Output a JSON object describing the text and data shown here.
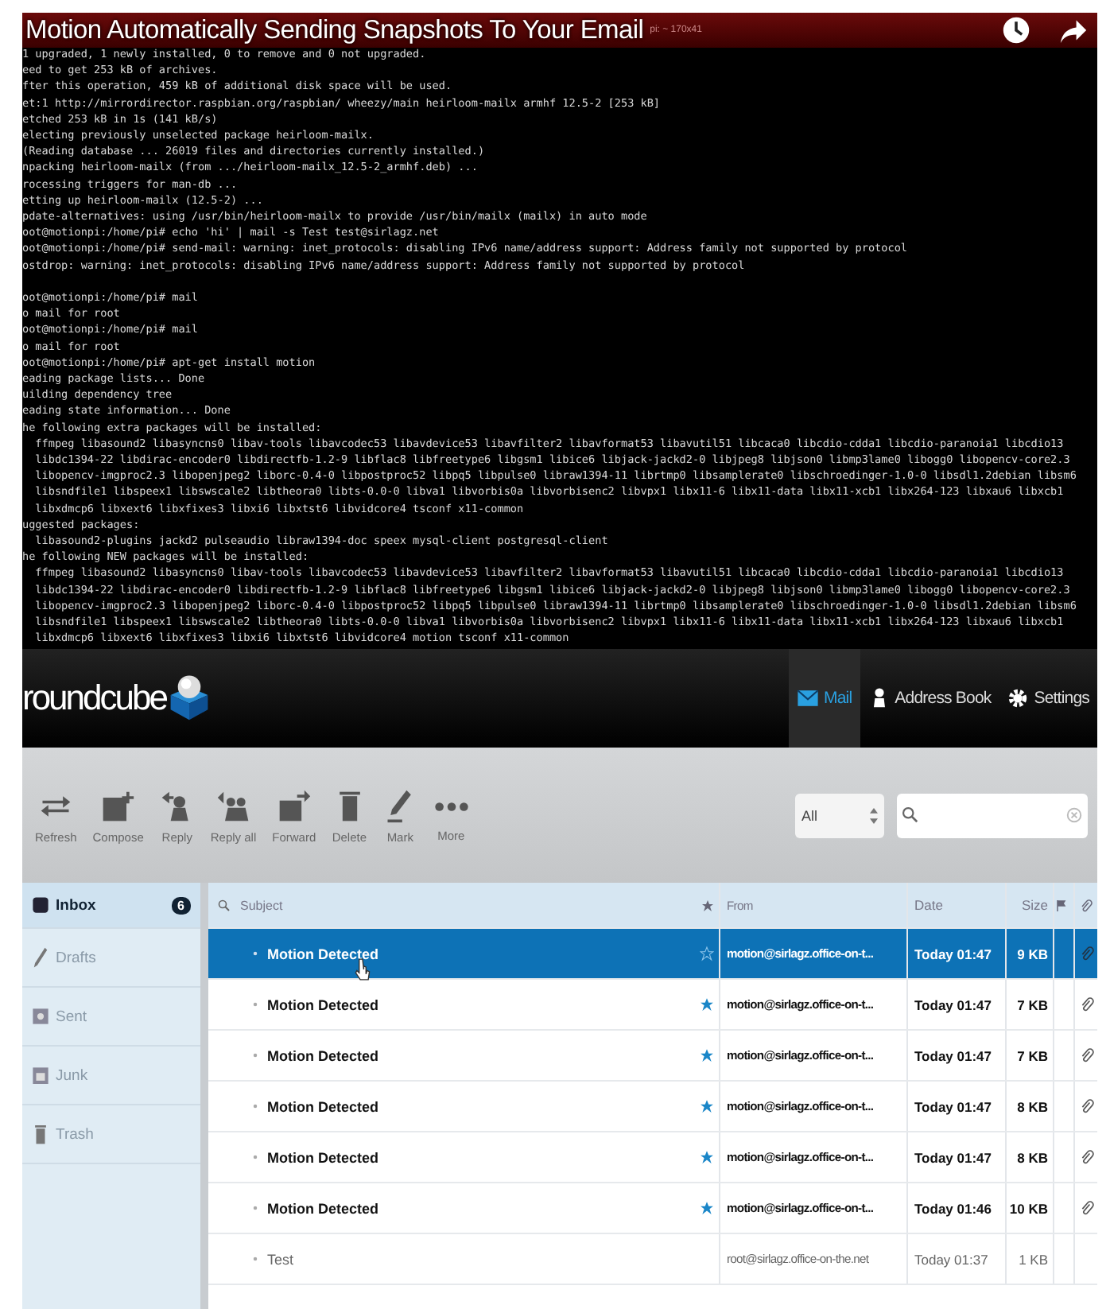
{
  "video": {
    "title": "Motion Automatically Sending Snapshots To Your Email",
    "terminal_title": "pi: ~ 170x41"
  },
  "terminal": {
    "blocks": [
      [
        "1 upgraded, 1 newly installed, 0 to remove and 0 not upgraded.",
        "eed to get 253 kB of archives.",
        "fter this operation, 459 kB of additional disk space will be used.",
        "et:1 http://mirrordirector.raspbian.org/raspbian/ wheezy/main heirloom-mailx armhf 12.5-2 [253 kB]",
        "etched 253 kB in 1s (141 kB/s)",
        "electing previously unselected package heirloom-mailx.",
        "(Reading database ... 26019 files and directories currently installed.)",
        "npacking heirloom-mailx (from .../heirloom-mailx_12.5-2_armhf.deb) ...",
        "rocessing triggers for man-db ...",
        "etting up heirloom-mailx (12.5-2) ...",
        "pdate-alternatives: using /usr/bin/heirloom-mailx to provide /usr/bin/mailx (mailx) in auto mode",
        "oot@motionpi:/home/pi# echo 'hi' | mail -s Test test@sirlagz.net",
        "oot@motionpi:/home/pi# send-mail: warning: inet_protocols: disabling IPv6 name/address support: Address family not supported by protocol",
        "ostdrop: warning: inet_protocols: disabling IPv6 name/address support: Address family not supported by protocol"
      ],
      [
        "oot@motionpi:/home/pi# mail",
        "o mail for root",
        "oot@motionpi:/home/pi# mail",
        "o mail for root",
        "oot@motionpi:/home/pi# apt-get install motion",
        "eading package lists... Done",
        "uilding dependency tree",
        "eading state information... Done",
        "he following extra packages will be installed:",
        "  ffmpeg libasound2 libasyncns0 libav-tools libavcodec53 libavdevice53 libavfilter2 libavformat53 libavutil51 libcaca0 libcdio-cdda1 libcdio-paranoia1 libcdio13",
        "  libdc1394-22 libdirac-encoder0 libdirectfb-1.2-9 libflac8 libfreetype6 libgsm1 libice6 libjack-jackd2-0 libjpeg8 libjson0 libmp3lame0 libogg0 libopencv-core2.3",
        "  libopencv-imgproc2.3 libopenjpeg2 liborc-0.4-0 libpostproc52 libpq5 libpulse0 libraw1394-11 librtmp0 libsamplerate0 libschroedinger-1.0-0 libsdl1.2debian libsm6",
        "  libsndfile1 libspeex1 libswscale2 libtheora0 libts-0.0-0 libva1 libvorbis0a libvorbisenc2 libvpx1 libx11-6 libx11-data libx11-xcb1 libx264-123 libxau6 libxcb1",
        "  libxdmcp6 libxext6 libxfixes3 libxi6 libxtst6 libvidcore4 tsconf x11-common",
        "uggested packages:",
        "  libasound2-plugins jackd2 pulseaudio libraw1394-doc speex mysql-client postgresql-client",
        "he following NEW packages will be installed:",
        "  ffmpeg libasound2 libasyncns0 libav-tools libavcodec53 libavdevice53 libavfilter2 libavformat53 libavutil51 libcaca0 libcdio-cdda1 libcdio-paranoia1 libcdio13",
        "  libdc1394-22 libdirac-encoder0 libdirectfb-1.2-9 libflac8 libfreetype6 libgsm1 libice6 libjack-jackd2-0 libjpeg8 libjson0 libmp3lame0 libogg0 libopencv-core2.3",
        "  libopencv-imgproc2.3 libopenjpeg2 liborc-0.4-0 libpostproc52 libpq5 libpulse0 libraw1394-11 librtmp0 libsamplerate0 libschroedinger-1.0-0 libsdl1.2debian libsm6",
        "  libsndfile1 libspeex1 libswscale2 libtheora0 libts-0.0-0 libva1 libvorbis0a libvorbisenc2 libvpx1 libx11-6 libx11-data libx11-xcb1 libx264-123 libxau6 libxcb1",
        "  libxdmcp6 libxext6 libxfixes3 libxi6 libxtst6 libvidcore4 motion tsconf x11-common"
      ]
    ]
  },
  "mail": {
    "logo": "roundcube",
    "nav": [
      {
        "label": "Mail",
        "selected": true,
        "kind": "mail"
      },
      {
        "label": "Address Book",
        "selected": false,
        "kind": "contacts"
      },
      {
        "label": "Settings",
        "selected": false,
        "kind": "settings"
      }
    ],
    "toolbar": [
      {
        "label": "Refresh",
        "kind": "refresh"
      },
      {
        "label": "Compose",
        "kind": "compose"
      },
      {
        "label": "Reply",
        "kind": "reply"
      },
      {
        "label": "Reply all",
        "kind": "replyall"
      },
      {
        "label": "Forward",
        "kind": "forward"
      },
      {
        "label": "Delete",
        "kind": "delete"
      },
      {
        "label": "Mark",
        "kind": "mark"
      },
      {
        "label": "More",
        "kind": "more"
      }
    ],
    "filter": "All",
    "folders": [
      {
        "label": "Inbox",
        "selected": true,
        "count": "6",
        "kind": "inbox"
      },
      {
        "label": "Drafts",
        "selected": false,
        "kind": "drafts"
      },
      {
        "label": "Sent",
        "selected": false,
        "kind": "sent"
      },
      {
        "label": "Junk",
        "selected": false,
        "kind": "junk"
      },
      {
        "label": "Trash",
        "selected": false,
        "kind": "trash"
      }
    ],
    "columns": {
      "subject": "Subject",
      "from": "From",
      "date": "Date",
      "size": "Size"
    },
    "messages": [
      {
        "subject": "Motion Detected",
        "from": "motion@sirlagz.office-on-t...",
        "date": "Today 01:47",
        "size": "9 KB",
        "selected": true,
        "unread": true,
        "flagged": false,
        "attachment": true
      },
      {
        "subject": "Motion Detected",
        "from": "motion@sirlagz.office-on-t...",
        "date": "Today 01:47",
        "size": "7 KB",
        "selected": false,
        "unread": true,
        "flagged": true,
        "attachment": true
      },
      {
        "subject": "Motion Detected",
        "from": "motion@sirlagz.office-on-t...",
        "date": "Today 01:47",
        "size": "7 KB",
        "selected": false,
        "unread": true,
        "flagged": true,
        "attachment": true
      },
      {
        "subject": "Motion Detected",
        "from": "motion@sirlagz.office-on-t...",
        "date": "Today 01:47",
        "size": "8 KB",
        "selected": false,
        "unread": true,
        "flagged": true,
        "attachment": true
      },
      {
        "subject": "Motion Detected",
        "from": "motion@sirlagz.office-on-t...",
        "date": "Today 01:47",
        "size": "8 KB",
        "selected": false,
        "unread": true,
        "flagged": true,
        "attachment": true
      },
      {
        "subject": "Motion Detected",
        "from": "motion@sirlagz.office-on-t...",
        "date": "Today 01:46",
        "size": "10 KB",
        "selected": false,
        "unread": true,
        "flagged": true,
        "attachment": true
      },
      {
        "subject": "Test",
        "from": "root@sirlagz.office-on-the.net",
        "date": "Today 01:37",
        "size": "1 KB",
        "selected": false,
        "unread": false,
        "flagged": false,
        "attachment": false
      }
    ]
  }
}
